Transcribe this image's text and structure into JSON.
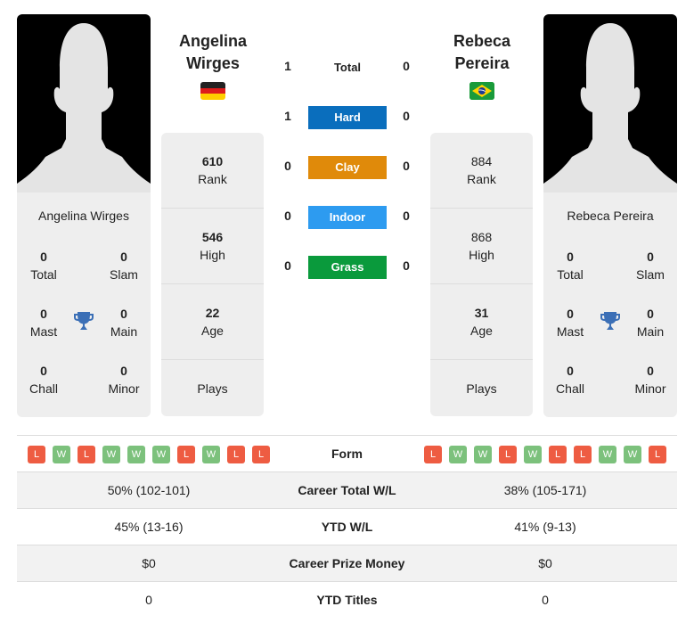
{
  "players": [
    {
      "name_line1": "Angelina",
      "name_line2": "Wirges",
      "full_name": "Angelina Wirges",
      "flag": "germany-flag",
      "titles": {
        "total": {
          "value": "0",
          "label": "Total"
        },
        "slam": {
          "value": "0",
          "label": "Slam"
        },
        "mast": {
          "value": "0",
          "label": "Mast"
        },
        "main": {
          "value": "0",
          "label": "Main"
        },
        "chall": {
          "value": "0",
          "label": "Chall"
        },
        "minor": {
          "value": "0",
          "label": "Minor"
        }
      },
      "stats": {
        "rank": {
          "value": "610",
          "label": "Rank"
        },
        "high": {
          "value": "546",
          "label": "High"
        },
        "age": {
          "value": "22",
          "label": "Age"
        },
        "plays": {
          "value": "",
          "label": "Plays"
        }
      },
      "form": [
        "L",
        "W",
        "L",
        "W",
        "W",
        "W",
        "L",
        "W",
        "L",
        "L"
      ]
    },
    {
      "name_line1": "Rebeca",
      "name_line2": "Pereira",
      "full_name": "Rebeca Pereira",
      "flag": "brazil-flag",
      "titles": {
        "total": {
          "value": "0",
          "label": "Total"
        },
        "slam": {
          "value": "0",
          "label": "Slam"
        },
        "mast": {
          "value": "0",
          "label": "Mast"
        },
        "main": {
          "value": "0",
          "label": "Main"
        },
        "chall": {
          "value": "0",
          "label": "Chall"
        },
        "minor": {
          "value": "0",
          "label": "Minor"
        }
      },
      "stats": {
        "rank": {
          "value": "884",
          "label": "Rank"
        },
        "high": {
          "value": "868",
          "label": "High"
        },
        "age": {
          "value": "31",
          "label": "Age"
        },
        "plays": {
          "value": "",
          "label": "Plays"
        }
      },
      "form": [
        "L",
        "W",
        "W",
        "L",
        "W",
        "L",
        "L",
        "W",
        "W",
        "L"
      ]
    }
  ],
  "h2h": [
    {
      "label": "Total",
      "left": "1",
      "right": "0",
      "color": ""
    },
    {
      "label": "Hard",
      "left": "1",
      "right": "0",
      "color": "#0a6ebd"
    },
    {
      "label": "Clay",
      "left": "0",
      "right": "0",
      "color": "#e08a0a"
    },
    {
      "label": "Indoor",
      "left": "0",
      "right": "0",
      "color": "#2d9bf0"
    },
    {
      "label": "Grass",
      "left": "0",
      "right": "0",
      "color": "#0a9a3c"
    }
  ],
  "form_colors": {
    "W": "#7cc17c",
    "L": "#ee5c42"
  },
  "comparison": {
    "form_label": "Form",
    "rows": [
      {
        "label": "Career Total W/L",
        "left": "50% (102-101)",
        "right": "38% (105-171)"
      },
      {
        "label": "YTD W/L",
        "left": "45% (13-16)",
        "right": "41% (9-13)"
      },
      {
        "label": "Career Prize Money",
        "left": "$0",
        "right": "$0"
      },
      {
        "label": "YTD Titles",
        "left": "0",
        "right": "0"
      }
    ]
  }
}
